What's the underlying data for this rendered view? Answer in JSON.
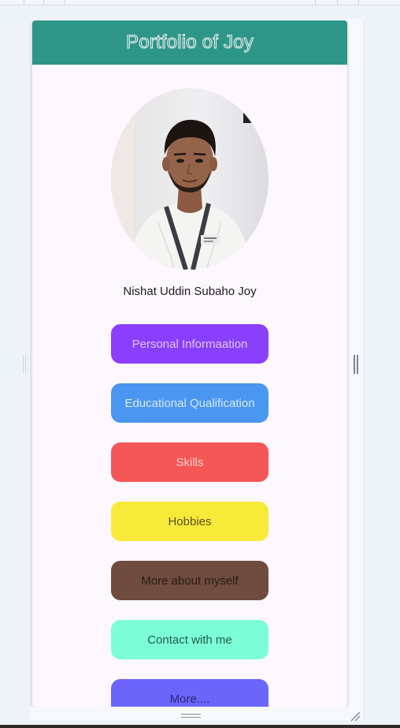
{
  "app": {
    "title": "Portfolio of Joy",
    "profile_name": "Nishat Uddin Subaho Joy",
    "avatar_alt": "profile photo"
  },
  "buttons": [
    {
      "label": "Personal Informaation",
      "bg": "#8a3ffc",
      "fg": "#dcc9ff"
    },
    {
      "label": "Educational Qualification",
      "bg": "#4a96f0",
      "fg": "#d9e9ff"
    },
    {
      "label": "Skills",
      "bg": "#f55656",
      "fg": "#ffd0d0"
    },
    {
      "label": "Hobbies",
      "bg": "#f8ea38",
      "fg": "#5a5420"
    },
    {
      "label": "More about myself",
      "bg": "#6f4c3e",
      "fg": "#2a1b14"
    },
    {
      "label": "Contact with me",
      "bg": "#7dffd6",
      "fg": "#1f5a4d"
    },
    {
      "label": "More....",
      "bg": "#6b65fb",
      "fg": "#2a2770"
    }
  ],
  "colors": {
    "appbar": "#2e9688",
    "surface": "#fdf7ff",
    "page_bg": "#eef3fa"
  }
}
